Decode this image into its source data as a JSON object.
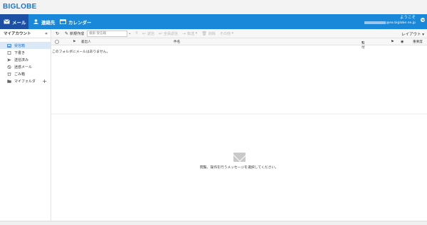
{
  "brand": {
    "logo": "BIGLOBE"
  },
  "nav": {
    "tabs": [
      {
        "label": "メール",
        "icon": "mail-icon",
        "active": true
      },
      {
        "label": "連絡先",
        "icon": "contacts-icon",
        "active": false
      },
      {
        "label": "カレンダー",
        "icon": "calendar-icon",
        "active": false
      }
    ],
    "welcome": "ようこそ",
    "email_domain": "@ea.biglobe.ne.jp"
  },
  "sidebar": {
    "title": "マイアカウント",
    "collapse_icon": "«",
    "folders": [
      {
        "label": "受信箱",
        "icon": "inbox-icon",
        "selected": true
      },
      {
        "label": "下書き",
        "icon": "draft-icon",
        "selected": false
      },
      {
        "label": "送信済み",
        "icon": "sent-icon",
        "selected": false
      },
      {
        "label": "迷惑メール",
        "icon": "spam-icon",
        "selected": false
      },
      {
        "label": "ごみ箱",
        "icon": "trash-icon",
        "selected": false
      },
      {
        "label": "マイフォルダ",
        "icon": "folder-icon",
        "selected": false
      }
    ]
  },
  "toolbar": {
    "compose": "新規作成",
    "search_placeholder": "検索:受信箱",
    "reply": "返信",
    "reply_all": "全員返信",
    "forward": "転送",
    "delete": "削除",
    "more": "その他",
    "layout": "レイアウト"
  },
  "list": {
    "col_sender": "差出人",
    "col_subject": "件名",
    "col_date": "日付",
    "col_priority": "重要度",
    "empty_message": "このフォルダにメールはありません。"
  },
  "preview": {
    "message": "閲覧、操作を行うメッセージを選択してください。"
  },
  "colors": {
    "nav_bar": "#1a88d8",
    "nav_active": "#1d4fa3",
    "accent": "#1a73d9"
  }
}
